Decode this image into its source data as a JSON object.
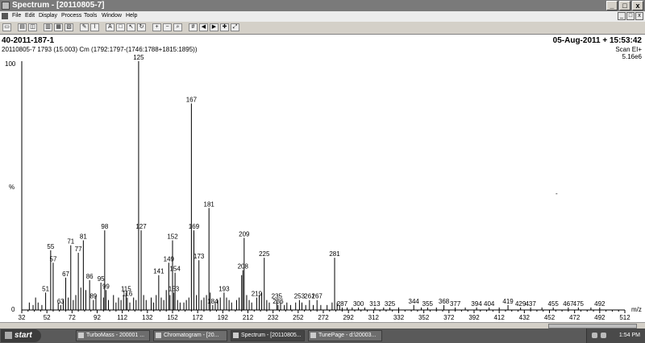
{
  "window": {
    "title": "Spectrum - [20110805-7]"
  },
  "menu": [
    "File",
    "Edit",
    "Display",
    "Process",
    "Tools",
    "Window",
    "Help"
  ],
  "window_controls": {
    "min": "_",
    "max": "□",
    "close": "x"
  },
  "toolbar_icons": [
    "copy-icon",
    "print-icon",
    "print-preview-icon",
    "copy-spectrum-icon",
    "copy-list-icon",
    "page-setup-icon",
    "edit-icon",
    "peak-label-icon",
    "text-icon",
    "box-icon",
    "arrow-icon",
    "refresh-icon",
    "zoom-in-icon",
    "zoom-out-icon",
    "zoom-fit-icon",
    "grid-icon",
    "prev-icon",
    "next-icon",
    "last-icon",
    "fullscreen-icon"
  ],
  "spectrum": {
    "sample_id": "40-2011-187-1",
    "datetime": "05-Aug-2011 + 15:53:42",
    "scan_info": "20110805-7 1793 (15.003) Cm (1792:1797-(1746:1788+1815:1895))",
    "scan_mode": "Scan EI+",
    "intensity": "5.16e6",
    "y_max_label": "100",
    "y_pct_label": "%",
    "y_min_label": "0",
    "x_unit": "m/z",
    "dash_mark": "-"
  },
  "chart_data": {
    "type": "bar",
    "x_label": "m/z",
    "y_label": "%",
    "xlim": [
      32,
      512
    ],
    "ylim": [
      0,
      100
    ],
    "x_ticks": [
      32,
      52,
      72,
      92,
      112,
      132,
      152,
      172,
      192,
      212,
      232,
      252,
      272,
      292,
      312,
      332,
      352,
      372,
      392,
      412,
      432,
      452,
      472,
      492,
      512
    ],
    "peaks": [
      {
        "mz": 38,
        "y": 3
      },
      {
        "mz": 41,
        "y": 2
      },
      {
        "mz": 43,
        "y": 5
      },
      {
        "mz": 45,
        "y": 3
      },
      {
        "mz": 48,
        "y": 2
      },
      {
        "mz": 51,
        "y": 7,
        "label": "51"
      },
      {
        "mz": 55,
        "y": 24,
        "label": "55"
      },
      {
        "mz": 57,
        "y": 19,
        "label": "57"
      },
      {
        "mz": 61,
        "y": 3
      },
      {
        "mz": 63,
        "y": 2,
        "label": "63"
      },
      {
        "mz": 65,
        "y": 4
      },
      {
        "mz": 67,
        "y": 13,
        "label": "67"
      },
      {
        "mz": 69,
        "y": 5
      },
      {
        "mz": 71,
        "y": 26,
        "label": "71"
      },
      {
        "mz": 73,
        "y": 4
      },
      {
        "mz": 75,
        "y": 6
      },
      {
        "mz": 77,
        "y": 23,
        "label": "77"
      },
      {
        "mz": 79,
        "y": 9
      },
      {
        "mz": 81,
        "y": 28,
        "label": "81"
      },
      {
        "mz": 83,
        "y": 8
      },
      {
        "mz": 86,
        "y": 12,
        "label": "86"
      },
      {
        "mz": 89,
        "y": 4,
        "label": "89"
      },
      {
        "mz": 91,
        "y": 6
      },
      {
        "mz": 95,
        "y": 11,
        "label": "95"
      },
      {
        "mz": 97,
        "y": 5
      },
      {
        "mz": 98,
        "y": 32,
        "label": "98"
      },
      {
        "mz": 99,
        "y": 8,
        "label": "99"
      },
      {
        "mz": 101,
        "y": 4
      },
      {
        "mz": 105,
        "y": 6
      },
      {
        "mz": 107,
        "y": 3
      },
      {
        "mz": 109,
        "y": 5
      },
      {
        "mz": 111,
        "y": 4
      },
      {
        "mz": 113,
        "y": 6
      },
      {
        "mz": 115,
        "y": 7,
        "label": "115"
      },
      {
        "mz": 116,
        "y": 5,
        "label": "116"
      },
      {
        "mz": 118,
        "y": 3
      },
      {
        "mz": 121,
        "y": 5
      },
      {
        "mz": 123,
        "y": 4
      },
      {
        "mz": 125,
        "y": 100,
        "label": "125"
      },
      {
        "mz": 127,
        "y": 32,
        "label": "127"
      },
      {
        "mz": 129,
        "y": 6
      },
      {
        "mz": 131,
        "y": 4
      },
      {
        "mz": 135,
        "y": 5
      },
      {
        "mz": 137,
        "y": 3
      },
      {
        "mz": 139,
        "y": 6
      },
      {
        "mz": 141,
        "y": 14,
        "label": "141"
      },
      {
        "mz": 143,
        "y": 5
      },
      {
        "mz": 145,
        "y": 4
      },
      {
        "mz": 147,
        "y": 8
      },
      {
        "mz": 149,
        "y": 19,
        "label": "149"
      },
      {
        "mz": 150,
        "y": 6
      },
      {
        "mz": 152,
        "y": 28,
        "label": "152"
      },
      {
        "mz": 153,
        "y": 7,
        "label": "153"
      },
      {
        "mz": 154,
        "y": 15,
        "label": "154"
      },
      {
        "mz": 156,
        "y": 4
      },
      {
        "mz": 158,
        "y": 3
      },
      {
        "mz": 161,
        "y": 3
      },
      {
        "mz": 163,
        "y": 4
      },
      {
        "mz": 165,
        "y": 5
      },
      {
        "mz": 167,
        "y": 83,
        "label": "167"
      },
      {
        "mz": 169,
        "y": 32,
        "label": "169"
      },
      {
        "mz": 171,
        "y": 6
      },
      {
        "mz": 173,
        "y": 20,
        "label": "173"
      },
      {
        "mz": 175,
        "y": 4
      },
      {
        "mz": 177,
        "y": 5
      },
      {
        "mz": 179,
        "y": 6
      },
      {
        "mz": 181,
        "y": 41,
        "label": "181"
      },
      {
        "mz": 182,
        "y": 7
      },
      {
        "mz": 184,
        "y": 2,
        "label": "184"
      },
      {
        "mz": 186,
        "y": 3
      },
      {
        "mz": 188,
        "y": 4
      },
      {
        "mz": 190,
        "y": 5
      },
      {
        "mz": 193,
        "y": 7,
        "label": "193"
      },
      {
        "mz": 195,
        "y": 5
      },
      {
        "mz": 197,
        "y": 4
      },
      {
        "mz": 199,
        "y": 3
      },
      {
        "mz": 203,
        "y": 4
      },
      {
        "mz": 205,
        "y": 5
      },
      {
        "mz": 207,
        "y": 14
      },
      {
        "mz": 208,
        "y": 16,
        "label": "208"
      },
      {
        "mz": 209,
        "y": 29,
        "label": "209"
      },
      {
        "mz": 211,
        "y": 6
      },
      {
        "mz": 213,
        "y": 4
      },
      {
        "mz": 215,
        "y": 3
      },
      {
        "mz": 219,
        "y": 5,
        "label": "219"
      },
      {
        "mz": 221,
        "y": 6
      },
      {
        "mz": 223,
        "y": 7
      },
      {
        "mz": 225,
        "y": 21,
        "label": "225"
      },
      {
        "mz": 227,
        "y": 4
      },
      {
        "mz": 229,
        "y": 3
      },
      {
        "mz": 235,
        "y": 4,
        "label": "235"
      },
      {
        "mz": 236,
        "y": 2,
        "label": "236"
      },
      {
        "mz": 238,
        "y": 3
      },
      {
        "mz": 241,
        "y": 2
      },
      {
        "mz": 243,
        "y": 3
      },
      {
        "mz": 246,
        "y": 2
      },
      {
        "mz": 250,
        "y": 3
      },
      {
        "mz": 253,
        "y": 4,
        "label": "253"
      },
      {
        "mz": 255,
        "y": 3
      },
      {
        "mz": 258,
        "y": 2
      },
      {
        "mz": 261,
        "y": 4,
        "label": "261"
      },
      {
        "mz": 264,
        "y": 2
      },
      {
        "mz": 267,
        "y": 4,
        "label": "267"
      },
      {
        "mz": 270,
        "y": 2
      },
      {
        "mz": 275,
        "y": 2
      },
      {
        "mz": 279,
        "y": 3
      },
      {
        "mz": 281,
        "y": 21,
        "label": "281"
      },
      {
        "mz": 283,
        "y": 3
      },
      {
        "mz": 285,
        "y": 2
      },
      {
        "mz": 287,
        "y": 1,
        "label": "287"
      },
      {
        "mz": 291,
        "y": 1
      },
      {
        "mz": 295,
        "y": 1
      },
      {
        "mz": 300,
        "y": 1,
        "label": "300"
      },
      {
        "mz": 305,
        "y": 1
      },
      {
        "mz": 313,
        "y": 1,
        "label": "313"
      },
      {
        "mz": 320,
        "y": 1
      },
      {
        "mz": 325,
        "y": 1,
        "label": "325"
      },
      {
        "mz": 332,
        "y": 1
      },
      {
        "mz": 344,
        "y": 2,
        "label": "344"
      },
      {
        "mz": 350,
        "y": 1
      },
      {
        "mz": 355,
        "y": 1,
        "label": "355"
      },
      {
        "mz": 362,
        "y": 1
      },
      {
        "mz": 368,
        "y": 2,
        "label": "368"
      },
      {
        "mz": 377,
        "y": 1,
        "label": "377"
      },
      {
        "mz": 385,
        "y": 1
      },
      {
        "mz": 394,
        "y": 1,
        "label": "394"
      },
      {
        "mz": 404,
        "y": 1,
        "label": "404"
      },
      {
        "mz": 412,
        "y": 1
      },
      {
        "mz": 419,
        "y": 2,
        "label": "419"
      },
      {
        "mz": 429,
        "y": 1,
        "label": "429"
      },
      {
        "mz": 437,
        "y": 1,
        "label": "437"
      },
      {
        "mz": 446,
        "y": 1
      },
      {
        "mz": 455,
        "y": 1,
        "label": "455"
      },
      {
        "mz": 467,
        "y": 1,
        "label": "467"
      },
      {
        "mz": 475,
        "y": 1,
        "label": "475"
      },
      {
        "mz": 485,
        "y": 1
      },
      {
        "mz": 492,
        "y": 1,
        "label": "492"
      }
    ]
  },
  "taskbar": {
    "start_label": "start",
    "tasks": [
      "TurboMass - 200001 ...",
      "Chromatogram - [20...",
      "Spectrum - [20110805...",
      "TunePage - d:\\20003..."
    ],
    "clock": "1:54 PM"
  }
}
